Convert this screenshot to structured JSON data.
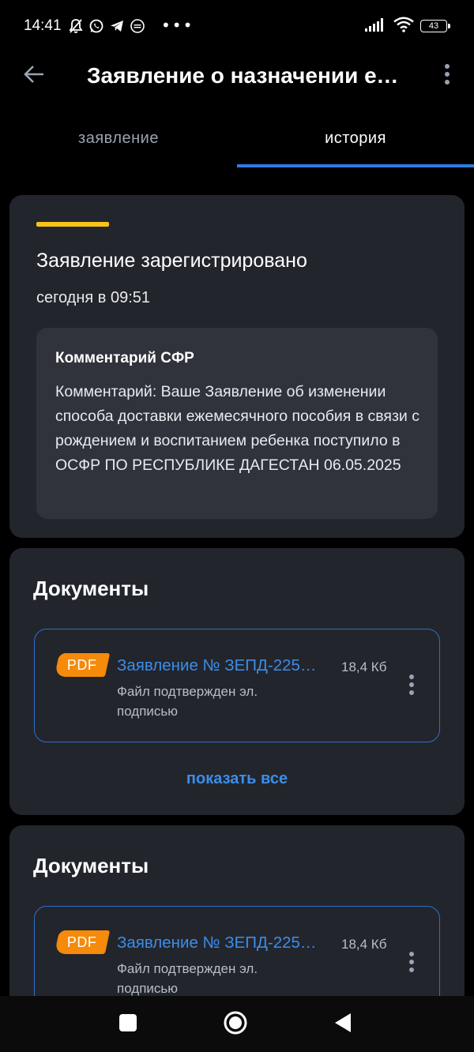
{
  "status_bar": {
    "time": "14:41",
    "left_icons": [
      "mute-bell-icon",
      "whatsapp-icon",
      "telegram-icon",
      "gosuslugi-icon"
    ],
    "dots": "•••",
    "right_icons": [
      "signal-icon",
      "wifi-icon",
      "battery-icon"
    ],
    "battery": "43"
  },
  "app_bar": {
    "title": "Заявление о назначении ежемесячного пособия",
    "back_icon": "arrow-left-icon",
    "more_icon": "more-vertical-icon"
  },
  "tabs": [
    {
      "label": "заявление",
      "active": false
    },
    {
      "label": "история",
      "active": true
    }
  ],
  "colors": {
    "background": "#000000",
    "card": "#23252d",
    "comment_box": "#30333b",
    "accent_yellow": "#f7c21a",
    "link_blue": "#3b8ee8",
    "tab_indicator": "#2f7de1",
    "pdf_orange": "#f58a0b"
  },
  "status_card": {
    "heading": "Заявление зарегистрировано",
    "time": "сегодня в 09:51",
    "comment_title": "Комментарий СФР",
    "comment_text": "Комментарий: Ваше Заявление об изменении способа доставки ежемесячного пособия в связи с рождением и воспитанием ребенка поступило в ОСФР ПО РЕСПУБЛИКЕ ДАГЕСТАН 06.05.2025"
  },
  "documents_cards": [
    {
      "heading": "Документы",
      "doc": {
        "badge": "PDF",
        "name": "Заявление № ЗЕПД-225…",
        "size": "18,4 Кб",
        "status": "Файл подтвержден эл. подписью"
      },
      "show_all": "показать все"
    },
    {
      "heading": "Документы",
      "doc": {
        "badge": "PDF",
        "name": "Заявление № ЗЕПД-225…",
        "size": "18,4 Кб",
        "status": "Файл подтвержден эл. подписью"
      }
    }
  ],
  "nav_bar": {
    "icons": [
      "recent-apps-icon",
      "home-icon",
      "back-triangle-icon"
    ]
  }
}
